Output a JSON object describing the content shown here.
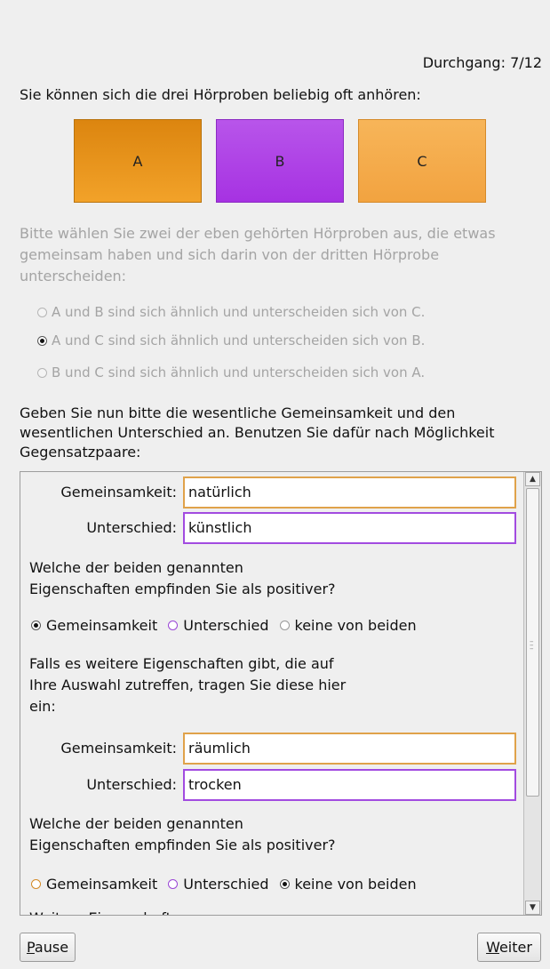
{
  "header": {
    "counter": "Durchgang: 7/12",
    "intro": "Sie können sich die drei Hörproben beliebig oft anhören:"
  },
  "samples": {
    "a": "A",
    "b": "B",
    "c": "C"
  },
  "question": {
    "text": "Bitte wählen Sie zwei der eben gehörten Hörproben aus, die etwas gemeinsam haben und sich darin von der dritten Hörprobe unterscheiden:",
    "options": [
      "A und B sind sich ähnlich und unterscheiden sich von C.",
      "A und C sind sich ähnlich und unterscheiden sich von B.",
      "B und C sind sich ähnlich und unterscheiden sich von A."
    ],
    "selected": 1
  },
  "instructions": "Geben Sie nun bitte die wesentliche Gemeinsamkeit und den wesentlichen Unterschied an. Benutzen Sie dafür nach Möglichkeit Gegensatzpaare:",
  "panel": {
    "label_common": "Gemeinsamkeit:",
    "label_diff": "Unterschied:",
    "pair1": {
      "common": "natürlich",
      "diff": "künstlich"
    },
    "pair2": {
      "common": "räumlich",
      "diff": "trocken"
    },
    "positive_q_line1": "Welche der beiden genannten",
    "positive_q_line2": "Eigenschaften empfinden Sie als positiver?",
    "opt_common": "Gemeinsamkeit",
    "opt_diff": "Unterschied",
    "opt_none": "keine von beiden",
    "more_line1": "Falls es weitere Eigenschaften gibt, die auf",
    "more_line2": "Ihre Auswahl zutreffen, tragen Sie diese hier",
    "more_line3": "ein:",
    "cutoff": "Weitere Eigenschaften"
  },
  "buttons": {
    "pause": "Pause",
    "next": "Weiter"
  },
  "colors": {
    "accent_orange": "#e0a24a",
    "accent_purple": "#a24be0"
  }
}
